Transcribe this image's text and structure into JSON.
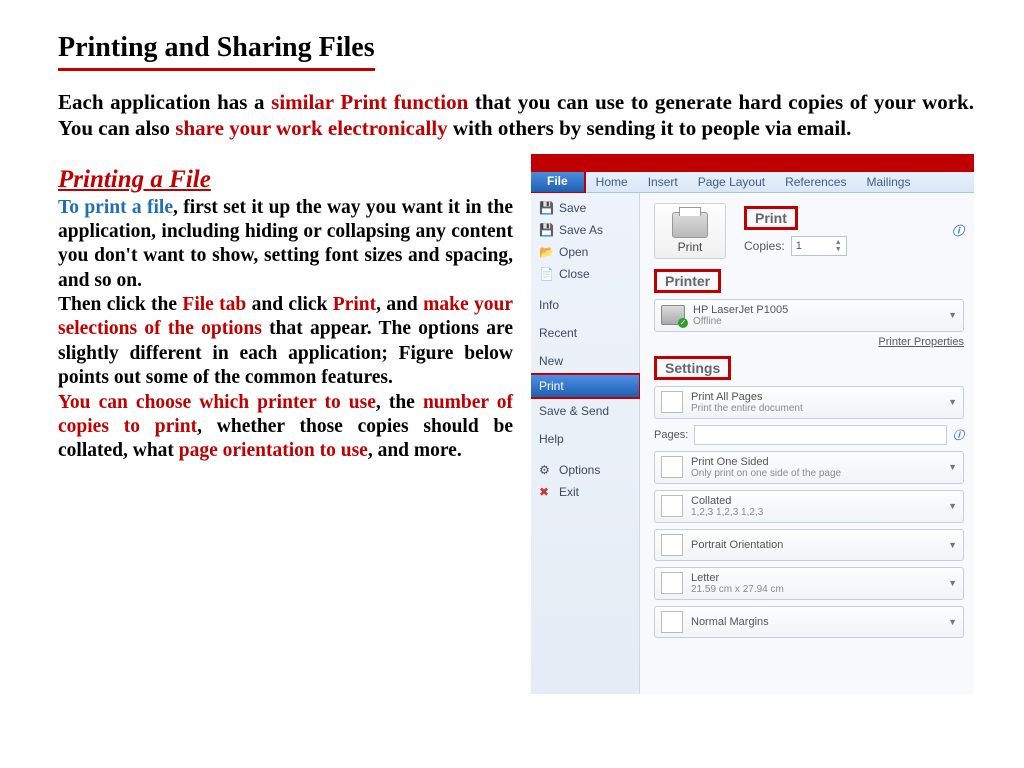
{
  "title": "Printing and Sharing Files",
  "intro": {
    "t1": "Each application has a ",
    "r1": "similar Print function",
    "t2": " that you can use to generate hard copies of your work. You can also ",
    "r2": "share your work electronically",
    "t3": " with others by sending it to people via email."
  },
  "subTitle": "Printing a File",
  "body": {
    "b1": "To print a file",
    "t1": ", first set it up the way you want it in the application, including hiding or collapsing any content you don't want to show, setting font sizes and spacing, and so on.",
    "t2a": "Then click the ",
    "r_file": "File tab",
    "t2b": " and click ",
    "r_print": "Print",
    "t2c": ", and ",
    "r_sel": "make your selections of the options",
    "t2d": " that appear. The options are slightly different in each application; Figure below points out some of the common features.",
    "r3a": "You can choose which printer to use",
    "t3a": ", the ",
    "r3b": "number of copies to print",
    "t3b": ", whether those copies should be collated, what ",
    "r3c": "page orientation to use",
    "t3c": ", and more."
  },
  "word": {
    "tabs": {
      "file": "File",
      "home": "Home",
      "insert": "Insert",
      "pageLayout": "Page Layout",
      "references": "References",
      "mailings": "Mailings"
    },
    "menu": {
      "save": "Save",
      "saveAs": "Save As",
      "open": "Open",
      "close": "Close",
      "info": "Info",
      "recent": "Recent",
      "new": "New",
      "print": "Print",
      "saveSend": "Save & Send",
      "help": "Help",
      "options": "Options",
      "exit": "Exit"
    },
    "panel": {
      "printHdr": "Print",
      "printBtn": "Print",
      "copiesLabel": "Copies:",
      "copiesVal": "1",
      "printerHdr": "Printer",
      "printerName": "HP LaserJet P1005",
      "printerStatus": "Offline",
      "printerProps": "Printer Properties",
      "settingsHdr": "Settings",
      "printAll": "Print All Pages",
      "printAllSub": "Print the entire document",
      "pagesLabel": "Pages:",
      "oneSided": "Print One Sided",
      "oneSidedSub": "Only print on one side of the page",
      "collated": "Collated",
      "collatedSub": "1,2,3   1,2,3   1,2,3",
      "portrait": "Portrait Orientation",
      "letter": "Letter",
      "letterSub": "21.59 cm x 27.94 cm",
      "margins": "Normal Margins"
    }
  }
}
